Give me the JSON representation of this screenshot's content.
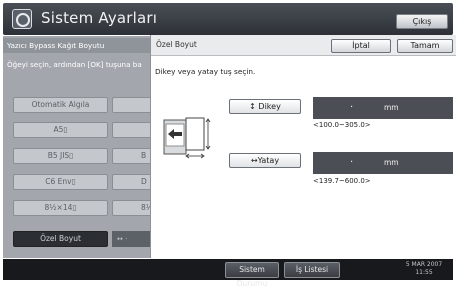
{
  "app": {
    "title": "Sistem Ayarları",
    "exit_label": "Çıkış"
  },
  "left_panel": {
    "header": "Yazıcı Bypass Kağıt Boyutu",
    "instruction": "Öğeyi seçin, ardından [OK] tuşuna ba",
    "buttons": [
      {
        "label": "Otomatik Algıla"
      },
      {
        "label": "A5▯"
      },
      {
        "label": "B5 JIS▯"
      },
      {
        "label": "C6 Env▯"
      },
      {
        "label": "8½×14▯"
      },
      {
        "label": "Özel Boyut",
        "selected": true
      }
    ],
    "col2_buttons": [
      "",
      "",
      "B",
      "D",
      "8½"
    ],
    "strip_text": "↔ ·"
  },
  "dialog": {
    "title": "Özel Boyut",
    "cancel_label": "İptal",
    "ok_label": "Tamam",
    "instruction": "Dikey veya yatay tuş seçin.",
    "vertical": {
      "button_label": "↕ Dikey",
      "value": ".",
      "unit": "mm",
      "range": "<100.0~305.0>"
    },
    "horizontal": {
      "button_label": "↔Yatay",
      "value": ".",
      "unit": "mm",
      "range": "<139.7~600.0>"
    }
  },
  "status_bar": {
    "system_status_label": "Sistem Durumu",
    "job_list_label": "İş Listesi",
    "date": "5 MAR 2007",
    "time": "11:55"
  },
  "colors": {
    "title_bar": "#3a3e45",
    "field_bg": "#4b4e54",
    "status_bar": "#17191c"
  }
}
